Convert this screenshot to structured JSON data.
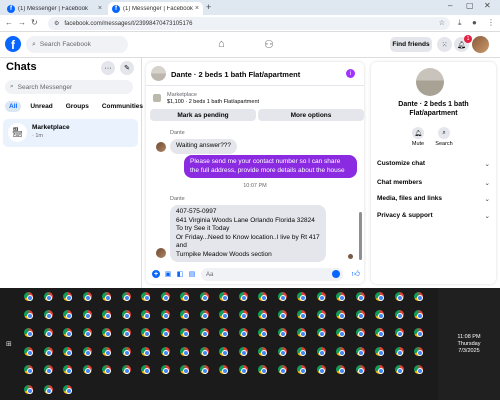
{
  "browser": {
    "tabs": [
      {
        "title": "(1) Messenger | Facebook",
        "active": false
      },
      {
        "title": "(1) Messenger | Facebook",
        "active": true
      }
    ],
    "url": "facebook.com/messages/t/23998470473105176"
  },
  "fb_header": {
    "logo": "f",
    "search_placeholder": "Search Facebook",
    "find_friends": "Find friends",
    "notif_count": "1"
  },
  "sidebar": {
    "title": "Chats",
    "search_placeholder": "Search Messenger",
    "filters": [
      "All",
      "Unread",
      "Groups",
      "Communities"
    ],
    "conversations": [
      {
        "name": "Marketplace",
        "sub": "· 1m"
      }
    ]
  },
  "conversation": {
    "title": "Dante · 2 beds 1 bath Flat/apartment",
    "marketplace_label": "Marketplace",
    "listing": "$1,100 · 2 beds 1 bath Flat/apartment",
    "mark_pending": "Mark as pending",
    "more_options": "More options",
    "messages": [
      {
        "sender": "Dante",
        "text": "Waiting answer???"
      },
      {
        "text": "Please send me your contact number so I can share the full address, provide more details about the house"
      },
      {
        "timestamp": "10:07 PM"
      },
      {
        "sender": "Dante",
        "lines": [
          "407-575-0997",
          "641 Virginia Woods Lane Orlando Florida 32824",
          "To try See it Today",
          "Or Friday...Need to Know location..I live by Rt 417 and",
          "Turnpike Meadow Woods section"
        ]
      }
    ],
    "composer_placeholder": "Aa"
  },
  "right_panel": {
    "title": "Dante · 2 beds 1 bath Flat/apartment",
    "actions": [
      "Mute",
      "Search"
    ],
    "sections": [
      "Customize chat",
      "Chat members",
      "Media, files and links",
      "Privacy & support"
    ]
  },
  "taskbar": {
    "time": "11:08 PM",
    "day": "Thursday",
    "date": "7/3/2025"
  },
  "colors": {
    "fb_blue": "#0866ff",
    "outgoing_bubble": "#8a2be2",
    "chrome_icon": [
      "#db4437",
      "#f4b400",
      "#0f9d58",
      "#4285f4"
    ]
  }
}
